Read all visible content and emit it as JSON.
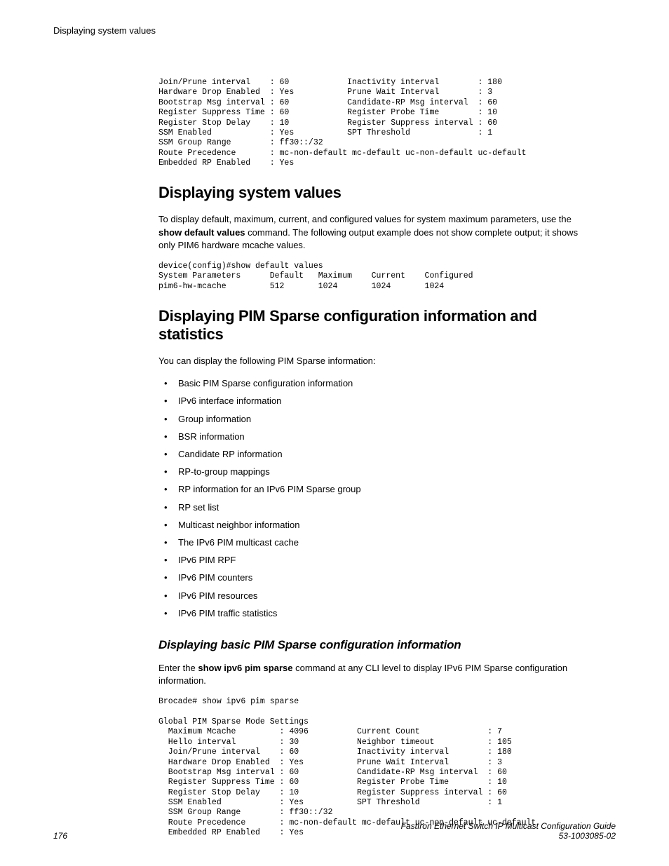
{
  "header": {
    "text": "Displaying system values"
  },
  "codeblock1": "Join/Prune interval    : 60            Inactivity interval        : 180\nHardware Drop Enabled  : Yes           Prune Wait Interval        : 3\nBootstrap Msg interval : 60            Candidate-RP Msg interval  : 60\nRegister Suppress Time : 60            Register Probe Time        : 10\nRegister Stop Delay    : 10            Register Suppress interval : 60\nSSM Enabled            : Yes           SPT Threshold              : 1\nSSM Group Range        : ff30::/32\nRoute Precedence       : mc-non-default mc-default uc-non-default uc-default\nEmbedded RP Enabled    : Yes",
  "section1": {
    "title": "Displaying system values",
    "para_before": "To display default, maximum, current, and configured values for system maximum parameters, use the ",
    "bold": "show default values",
    "para_after": " command. The following output example does not show complete output; it shows only PIM6 hardware mcache values."
  },
  "codeblock2": "device(config)#show default values\nSystem Parameters      Default   Maximum    Current    Configured\npim6-hw-mcache         512       1024       1024       1024",
  "section2": {
    "title": "Displaying PIM Sparse configuration information and statistics",
    "intro": "You can display the following PIM Sparse information:",
    "items": [
      "Basic PIM Sparse configuration information",
      "IPv6 interface information",
      "Group information",
      "BSR information",
      "Candidate RP information",
      "RP-to-group mappings",
      "RP information for an IPv6 PIM Sparse group",
      "RP set list",
      "Multicast neighbor information",
      "The IPv6 PIM multicast cache",
      "IPv6 PIM RPF",
      "IPv6 PIM counters",
      "IPv6 PIM resources",
      "IPv6 PIM traffic statistics"
    ]
  },
  "subsection": {
    "title": "Displaying basic PIM Sparse configuration information",
    "para_before": "Enter the ",
    "bold": "show ipv6 pim sparse",
    "para_after": " command at any CLI level to display IPv6 PIM Sparse configuration information."
  },
  "codeblock3": "Brocade# show ipv6 pim sparse\n\nGlobal PIM Sparse Mode Settings\n  Maximum Mcache         : 4096          Current Count              : 7\n  Hello interval         : 30            Neighbor timeout           : 105\n  Join/Prune interval    : 60            Inactivity interval        : 180\n  Hardware Drop Enabled  : Yes           Prune Wait Interval        : 3\n  Bootstrap Msg interval : 60            Candidate-RP Msg interval  : 60\n  Register Suppress Time : 60            Register Probe Time        : 10\n  Register Stop Delay    : 10            Register Suppress interval : 60\n  SSM Enabled            : Yes           SPT Threshold              : 1\n  SSM Group Range        : ff30::/32\n  Route Precedence       : mc-non-default mc-default uc-non-default uc-default\n  Embedded RP Enabled    : Yes",
  "footer": {
    "page": "176",
    "doc_title": "FastIron Ethernet Switch IP Multicast Configuration Guide",
    "doc_number": "53-1003085-02"
  }
}
